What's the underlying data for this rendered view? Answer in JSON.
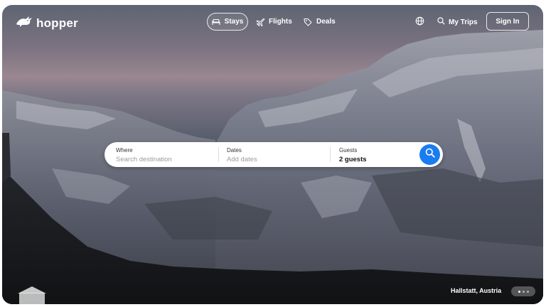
{
  "brand": {
    "name": "hopper",
    "logo_icon": "bunny-icon"
  },
  "nav": {
    "tabs": [
      {
        "label": "Stays",
        "icon": "bed-icon",
        "active": true
      },
      {
        "label": "Flights",
        "icon": "airplane-icon",
        "active": false
      },
      {
        "label": "Deals",
        "icon": "tag-icon",
        "active": false
      }
    ],
    "language_icon": "globe-icon",
    "my_trips_label": "My Trips",
    "my_trips_icon": "search-icon",
    "sign_in_label": "Sign In"
  },
  "search": {
    "where": {
      "label": "Where",
      "placeholder": "Search destination"
    },
    "dates": {
      "label": "Dates",
      "placeholder": "Add dates"
    },
    "guests": {
      "label": "Guests",
      "value": "2 guests"
    },
    "button_icon": "search-icon"
  },
  "hero": {
    "location": "Hallstatt, Austria",
    "carousel": {
      "count": 3,
      "active_index": 0
    }
  },
  "colors": {
    "accent": "#1a7cf0",
    "text_on_image": "#ffffff"
  }
}
